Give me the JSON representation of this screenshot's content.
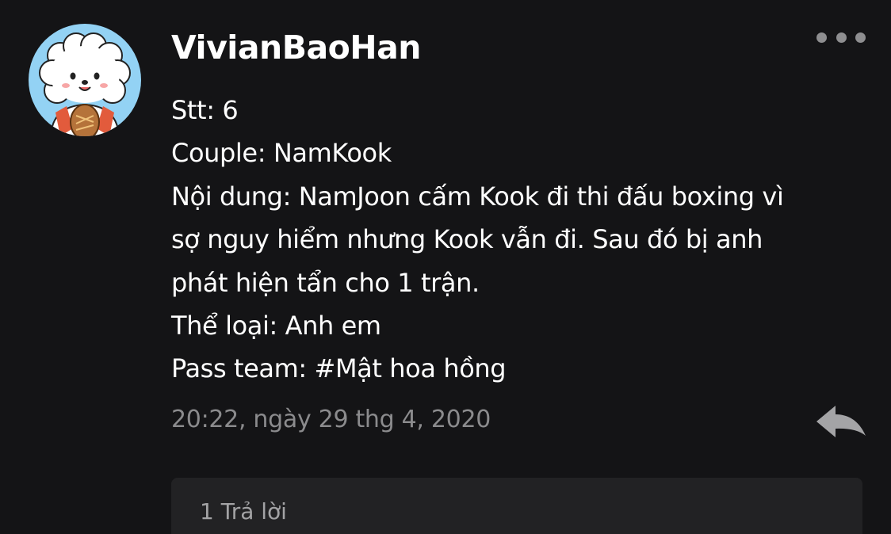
{
  "comment": {
    "username": "VivianBaoHan",
    "avatar_icon": "rj-character-avatar-icon",
    "body_lines": [
      "Stt: 6",
      "Couple: NamKook",
      "Nội dung: NamJoon cấm Kook đi thi đấu boxing vì",
      "sợ nguy hiểm nhưng Kook vẫn đi. Sau đó bị anh",
      "phát hiện tẩn cho 1 trận.",
      "Thể loại: Anh em",
      "Pass team: #Mật hoa hồng"
    ],
    "timestamp": "20:22, ngày 29 thg 4, 2020",
    "more_icon": "more-options-icon",
    "reply_icon": "reply-arrow-icon",
    "replies_label": "1 Trả lời"
  },
  "colors": {
    "background": "#141416",
    "text": "#ffffff",
    "muted": "#8b8b8d",
    "reply_box": "#222224",
    "avatar_bg": "#93d2f4"
  }
}
